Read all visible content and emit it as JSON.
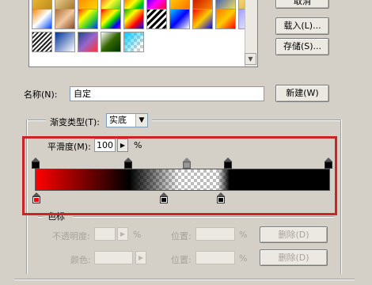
{
  "buttons": {
    "cancel_label": "取消",
    "load_label": "载入(L)...",
    "save_label": "存储(S)...",
    "new_label": "新建(W)",
    "delete_opacity_label": "删除(D)",
    "delete_color_label": "删除(D)"
  },
  "name_row": {
    "label": "名称(N):",
    "value": "自定"
  },
  "gradient_type": {
    "label": "渐变类型(T):",
    "value": "实底"
  },
  "smoothness": {
    "label": "平滑度(M):",
    "value": "100",
    "unit": "%"
  },
  "stops_group": {
    "title": "色标",
    "opacity_label": "不透明度:",
    "opacity_unit": "%",
    "position_label": "位置:",
    "position_unit": "%",
    "color_label": "颜色:",
    "color_position_label": "位置:",
    "color_position_unit": "%"
  },
  "colors": {
    "highlight": "#cc2229",
    "gradient_start": "#ff0000",
    "gradient_end": "#000000"
  },
  "icons": {
    "scroll_down": "▼",
    "arrow_right": "▶",
    "dropdown": "▼"
  }
}
